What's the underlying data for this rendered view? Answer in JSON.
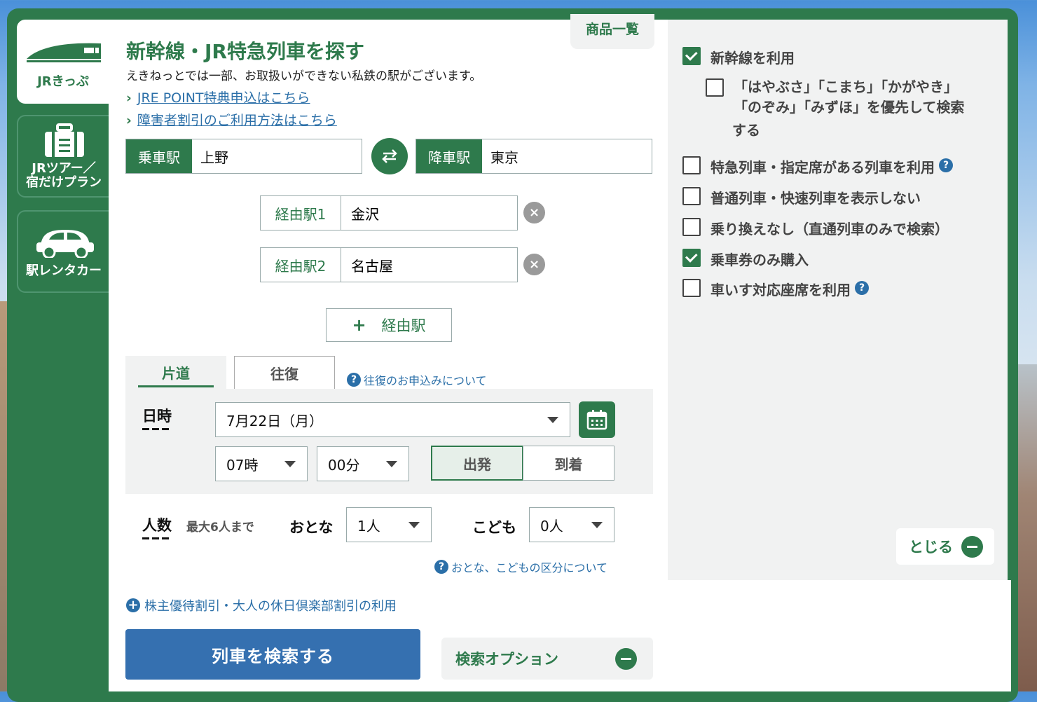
{
  "nav": {
    "items": [
      {
        "label": "JRきっぷ",
        "icon": "shinkansen-icon"
      },
      {
        "label_line1": "JRツアー／",
        "label_line2": "宿だけプラン",
        "icon": "suitcase-icon"
      },
      {
        "label": "駅レンタカー",
        "icon": "car-icon"
      }
    ]
  },
  "header": {
    "product_list": "商品一覧",
    "title": "新幹線・JR特急列車を探す",
    "notice": "えきねっとでは一部、お取扱いができない私鉄の駅がございます。",
    "links": [
      "JRE POINT特典申込はこちら",
      "障害者割引のご利用方法はこちら"
    ]
  },
  "stations": {
    "from_label": "乗車駅",
    "from_value": "上野",
    "to_label": "降車駅",
    "to_value": "東京",
    "via": [
      {
        "label": "経由駅1",
        "value": "金沢"
      },
      {
        "label": "経由駅2",
        "value": "名古屋"
      }
    ],
    "add_via": "経由駅",
    "add_symbol": "+",
    "clear_symbol": "×"
  },
  "trip": {
    "tabs": [
      "片道",
      "往復"
    ],
    "help": "往復のお申込みについて",
    "help_icon": "?"
  },
  "datetime": {
    "label": "日時",
    "date": "7月22日（月）",
    "hour": "07時",
    "minute": "00分",
    "depart": "出発",
    "arrive": "到着"
  },
  "passengers": {
    "label": "人数",
    "max": "最大6人まで",
    "adult_label": "おとな",
    "adult_value": "1人",
    "child_label": "こども",
    "child_value": "0人",
    "help": "おとな、こどもの区分について"
  },
  "discount": {
    "label": "株主優待割引・大人の休日倶楽部割引の利用",
    "plus": "+"
  },
  "actions": {
    "search": "列車を検索する",
    "options": "検索オプション"
  },
  "options": {
    "items": [
      {
        "label": "新幹線を利用",
        "checked": true
      },
      {
        "label_line1": "「はやぶさ」「こまち」「かがやき」",
        "label_line2": "「のぞみ」「みずほ」を優先して検索",
        "label_line3": "する",
        "checked": false
      },
      {
        "label": "特急列車・指定席がある列車を利用",
        "checked": false
      },
      {
        "label": "普通列車・快速列車を表示しない",
        "checked": false
      },
      {
        "label": "乗り換えなし（直通列車のみで検索）",
        "checked": false
      },
      {
        "label": "乗車券のみ購入",
        "checked": true
      },
      {
        "label": "車いす対応座席を利用",
        "checked": false
      }
    ],
    "close": "とじる"
  },
  "colors": {
    "brand_green": "#2e7a4c",
    "link_blue": "#2b6fa8",
    "button_blue": "#3570b0"
  }
}
